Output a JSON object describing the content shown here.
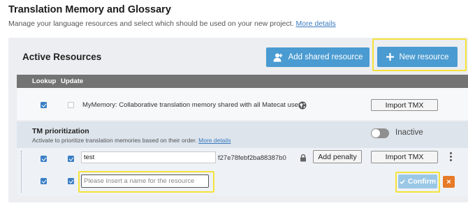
{
  "header": {
    "title": "Translation Memory and Glossary",
    "description": "Manage your language resources and select which should be used on your new project.",
    "more_details": "More details"
  },
  "active_resources": {
    "title": "Active Resources",
    "add_shared_label": "Add shared resource",
    "new_resource_label": "New resource"
  },
  "table": {
    "col_lookup": "Lookup",
    "col_update": "Update"
  },
  "mymemory": {
    "name": "MyMemory: Collaborative translation memory shared with all Matecat user",
    "lookup": true,
    "update": false,
    "import_label": "Import TMX"
  },
  "prioritization": {
    "title": "TM prioritization",
    "description": "Activate to prioritize translation memories based on their order.",
    "more_details": "More details",
    "status": "Inactive"
  },
  "resource_test": {
    "name": "test",
    "key": "f27e78febf2ba88387b0",
    "lookup": true,
    "update": true,
    "penalty_label": "Add penalty",
    "import_label": "Import TMX"
  },
  "new_resource": {
    "lookup": true,
    "update": true,
    "value": "",
    "placeholder": "Please insert a name for the resource",
    "confirm_label": "Confirm",
    "close_label": "×"
  },
  "colors": {
    "accent_blue": "#4a9bd1",
    "highlight_yellow": "#f5e23a",
    "close_orange": "#e67a27",
    "header_gray": "#737373"
  }
}
